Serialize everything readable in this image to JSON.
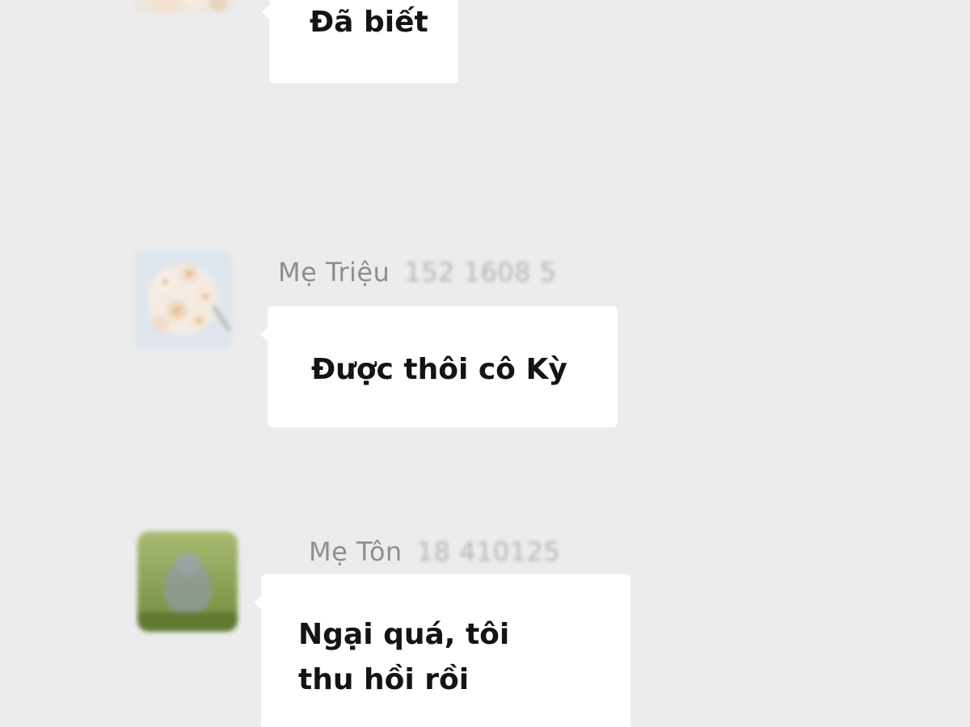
{
  "messages": [
    {
      "sender_name": "",
      "sender_phone": "",
      "text": "Đã biết",
      "avatar_icon": "flower-avatar-icon"
    },
    {
      "sender_name": "Mẹ Triệu",
      "sender_phone": "152  1608  5",
      "text": "Được thôi cô Kỳ",
      "avatar_icon": "cherry-blossom-avatar-icon"
    },
    {
      "sender_name": "Mẹ Tôn",
      "sender_phone": "18   410125",
      "text": "Ngại quá, tôi thu hồi rồi",
      "avatar_icon": "green-landscape-avatar-icon"
    }
  ],
  "colors": {
    "background": "#ececec",
    "bubble": "#ffffff",
    "sender_text": "#9b9b9b",
    "message_text": "#141414"
  }
}
